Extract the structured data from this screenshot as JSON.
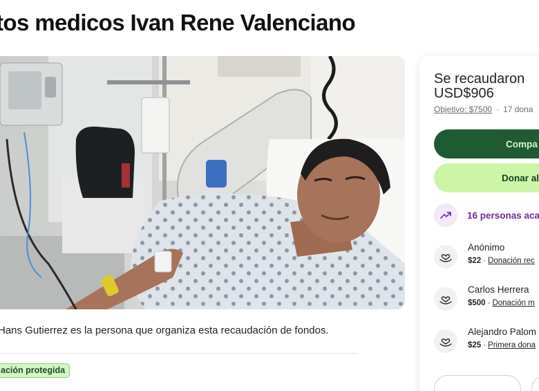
{
  "campaign": {
    "title": "tos medicos Ivan Rene Valenciano",
    "organizer_text": "Hans Gutierrez es la persona que organiza esta recaudación de fondos.",
    "protected_badge": "ación protegida"
  },
  "donation_card": {
    "raised_label": "Se recaudaron",
    "raised_amount": "USD$906",
    "goal": "Objetivo: $7500",
    "separator": "·",
    "donations_count": "17 dona",
    "share_button": "Compa",
    "donate_button": "Donar al",
    "trending_text": "16 personas acal",
    "donors": [
      {
        "name": "Anónimo",
        "amount": "$22",
        "separator": "·",
        "type": "Donación rec"
      },
      {
        "name": "Carlos Herrera",
        "amount": "$500",
        "separator": "·",
        "type": "Donación m"
      },
      {
        "name": "Alejandro Palom",
        "amount": "$25",
        "separator": "·",
        "type": "Primera dona"
      }
    ]
  },
  "icons": {
    "trending": "trending-up-icon",
    "donor": "heart-hand-icon"
  },
  "colors": {
    "share_button_bg": "#1f5a33",
    "donate_button_bg": "#cdf5a8",
    "trending_text": "#6e2a9e",
    "badge_bg": "#d4f5c4"
  }
}
